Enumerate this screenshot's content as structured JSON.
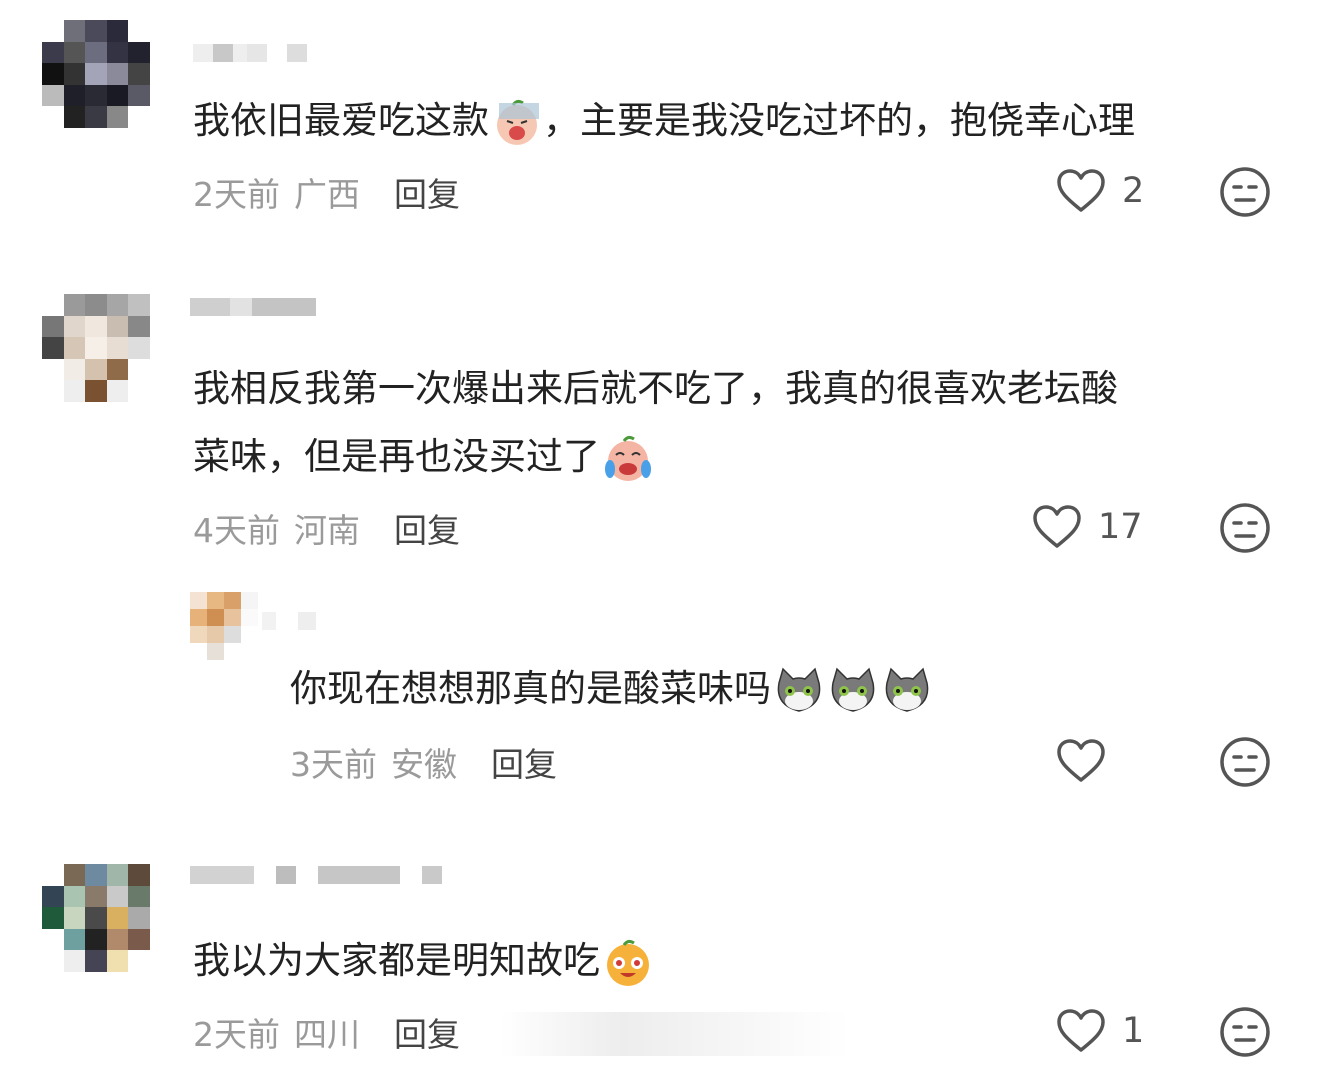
{
  "comments": [
    {
      "text": "我依旧最爱吃这款",
      "text_after": "，主要是我没吃过坏的，抱侥幸心理",
      "time": "2天前",
      "location": "广西",
      "reply_label": "回复",
      "likes": "2",
      "emoji": "crying-peach-emoji"
    },
    {
      "text_line1": "我相反我第一次爆出来后就不吃了，我真的很喜欢老坛酸",
      "text_line2": "菜味，但是再也没买过了",
      "time": "4天前",
      "location": "河南",
      "reply_label": "回复",
      "likes": "17",
      "emoji": "laugh-cry-peach-emoji",
      "replies": [
        {
          "text": "你现在想想那真的是酸菜味吗",
          "time": "3天前",
          "location": "安徽",
          "reply_label": "回复",
          "likes": "",
          "emoji": "cat-emoji"
        }
      ]
    },
    {
      "text": "我以为大家都是明知故吃",
      "time": "2天前",
      "location": "四川",
      "reply_label": "回复",
      "likes": "1",
      "emoji": "star-eyes-emoji"
    }
  ],
  "icons": {
    "like": "heart-outline-icon",
    "dislike": "neutral-face-icon"
  },
  "colors": {
    "text": "#222222",
    "meta": "#9a9a9a",
    "icon": "#555555"
  }
}
